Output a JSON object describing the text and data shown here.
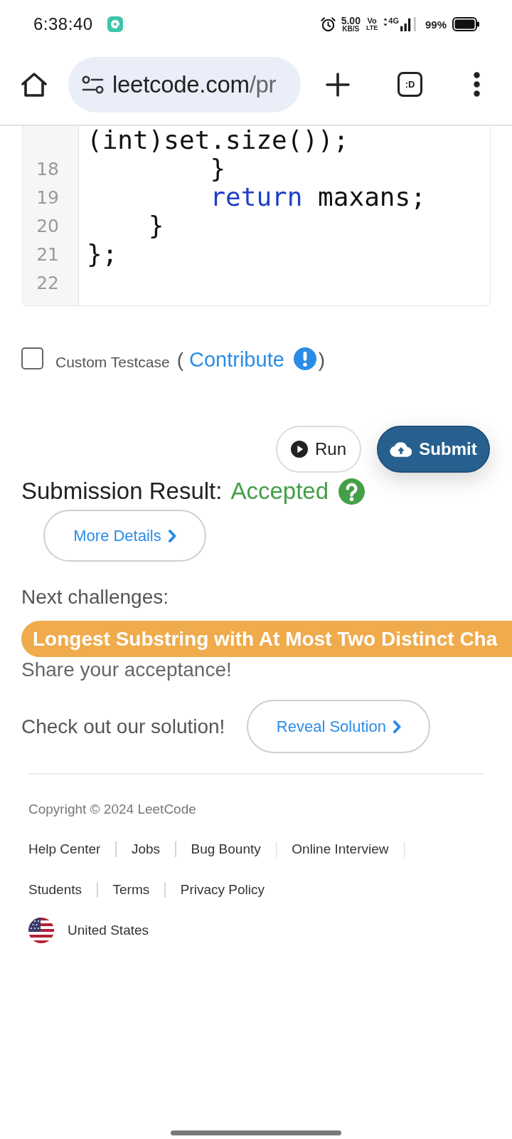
{
  "status_bar": {
    "time": "6:38:40",
    "speed_value": "5.00",
    "speed_unit": "KB/S",
    "volte_top": "Vo",
    "volte_bottom": "LTE",
    "network_type": "4G",
    "battery_percent": "99%"
  },
  "browser": {
    "url_host": "leetcode.com",
    "url_path": "/pr",
    "tab_count": ":D"
  },
  "code_editor": {
    "lines": [
      {
        "tokens": [
          {
            "kind": "plain",
            "text": "(int)set.size());"
          }
        ]
      },
      {
        "number": "18",
        "tokens": [
          {
            "kind": "plain",
            "text": "        }"
          }
        ]
      },
      {
        "number": "19",
        "tokens": [
          {
            "kind": "keyword",
            "text": "        return"
          },
          {
            "kind": "plain",
            "text": " maxans;"
          }
        ]
      },
      {
        "number": "20",
        "tokens": [
          {
            "kind": "plain",
            "text": "    }"
          }
        ]
      },
      {
        "number": "21",
        "tokens": [
          {
            "kind": "plain",
            "text": "};"
          }
        ]
      },
      {
        "number": "22"
      }
    ]
  },
  "custom_testcase": {
    "checked": false,
    "label": "Custom Testcase",
    "open_paren": "(",
    "link": "Contribute",
    "close_paren": ")"
  },
  "actions": [
    {
      "kind": "run",
      "label": "Run"
    },
    {
      "kind": "submit",
      "label": "Submit"
    }
  ],
  "submission": {
    "label": "Submission Result:",
    "status": "Accepted",
    "details_button": "More Details"
  },
  "next_challenges": {
    "heading": "Next challenges:",
    "items": [
      {
        "title": "Longest Substring with At Most Two Distinct Cha",
        "color": "#efab4c"
      }
    ]
  },
  "share_text": "Share your acceptance!",
  "solution": {
    "text": "Check out our solution!",
    "button": "Reveal Solution"
  },
  "footer": {
    "copyright": "Copyright © 2024 LeetCode",
    "links": [
      "Help Center",
      "Jobs",
      "Bug Bounty",
      "Online Interview",
      "Students",
      "Terms",
      "Privacy Policy"
    ],
    "region": "United States"
  }
}
